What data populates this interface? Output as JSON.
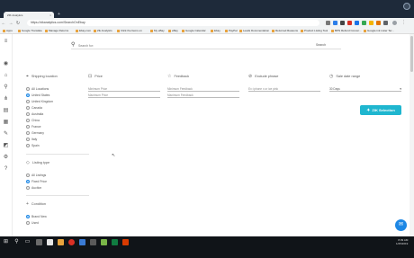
{
  "browser": {
    "tab_title": "ZIK Analytics",
    "tab_close": "×",
    "new_tab": "+",
    "url": "https://zikanalytics.com/SearchOnEbay",
    "bookmarks": [
      "Apps",
      "Google Translate",
      "Manage Returns",
      "Ebay.com",
      "Zik Analytics",
      "Click the Items on",
      "My eBay",
      "eBay",
      "Google Calendar",
      "Ebay",
      "PayPal",
      "Leads Documentation",
      "Returned Reasons",
      "Product Listing Tool",
      "BPN Refund Conver...",
      "Google ink Lister Ter..."
    ]
  },
  "search": {
    "placeholder": "Search for:",
    "button": "Search"
  },
  "shipping": {
    "title": "Shipping location",
    "options": [
      {
        "label": "All Locations",
        "selected": false
      },
      {
        "label": "United States",
        "selected": true
      },
      {
        "label": "United Kingdom",
        "selected": false
      },
      {
        "label": "Canada",
        "selected": false
      },
      {
        "label": "Australia",
        "selected": false
      },
      {
        "label": "China",
        "selected": false
      },
      {
        "label": "France",
        "selected": false
      },
      {
        "label": "Germany",
        "selected": false
      },
      {
        "label": "Italy",
        "selected": false
      },
      {
        "label": "Spain",
        "selected": false
      }
    ]
  },
  "price": {
    "title": "Price",
    "min_placeholder": "Minimum Price",
    "max_placeholder": "Maximum Price"
  },
  "feedback": {
    "title": "Feedback",
    "min_placeholder": "Minimum Feedback",
    "max_placeholder": "Maximum Feedback"
  },
  "exclude": {
    "title": "Exclude phrase",
    "placeholder": "Ex: iphone x or ice pink"
  },
  "sale_range": {
    "title": "Sale date range",
    "value": "30 Days"
  },
  "zik_button": "ZIK Selection",
  "listing": {
    "title": "Listing type",
    "options": [
      {
        "label": "All Listings",
        "selected": false
      },
      {
        "label": "Fixed Price",
        "selected": true
      },
      {
        "label": "Auction",
        "selected": false
      }
    ]
  },
  "condition": {
    "title": "Condition",
    "options": [
      {
        "label": "Brand New",
        "selected": true
      },
      {
        "label": "Used",
        "selected": false
      }
    ]
  },
  "clock": {
    "time": "8:39 AM",
    "date": "1/25/2019"
  }
}
